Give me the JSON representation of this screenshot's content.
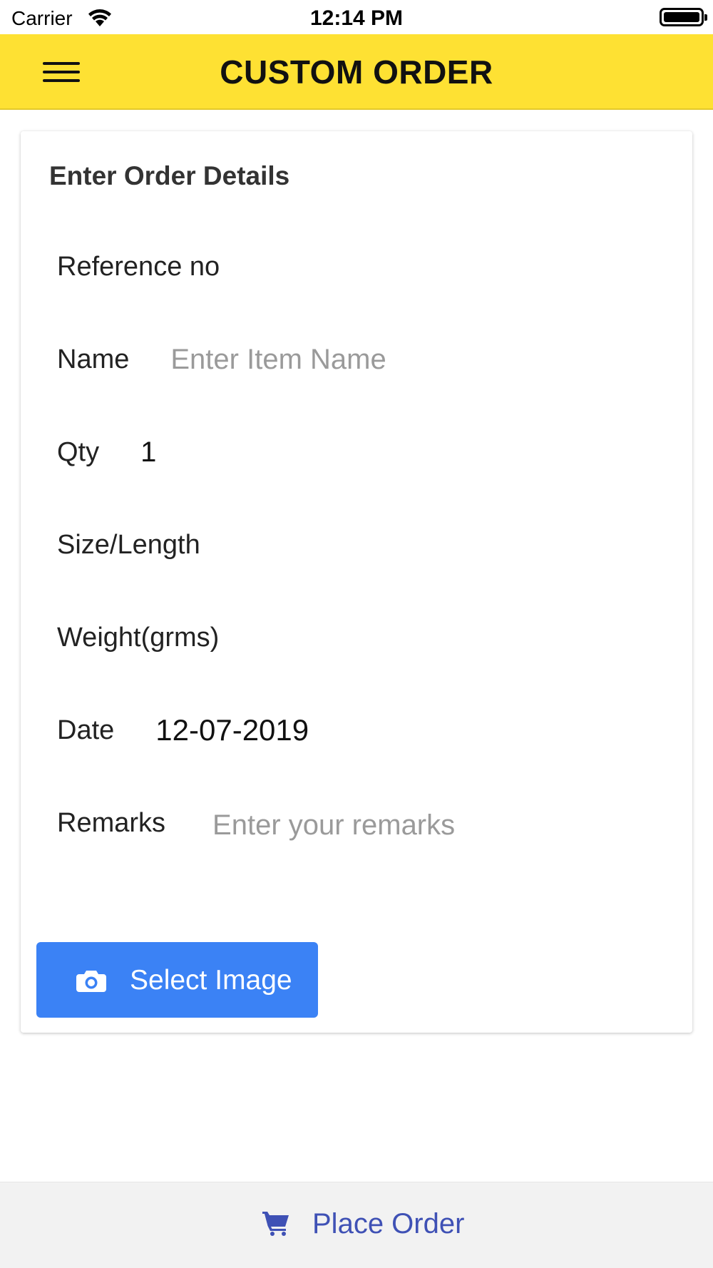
{
  "status_bar": {
    "carrier": "Carrier",
    "time": "12:14 PM",
    "icons": [
      "wifi-icon",
      "battery-icon"
    ]
  },
  "header": {
    "title": "CUSTOM ORDER",
    "menu_icon": "hamburger-menu-icon",
    "background": "#fee133"
  },
  "form": {
    "title": "Enter Order Details",
    "reference": {
      "label": "Reference no",
      "value": ""
    },
    "name": {
      "label": "Name",
      "value": "",
      "placeholder": "Enter Item Name"
    },
    "qty": {
      "label": "Qty",
      "value": "1"
    },
    "size": {
      "label": "Size/Length",
      "value": ""
    },
    "weight": {
      "label": "Weight(grms)",
      "value": ""
    },
    "date": {
      "label": "Date",
      "value": "12-07-2019"
    },
    "remarks": {
      "label": "Remarks",
      "value": "",
      "placeholder": "Enter your remarks"
    },
    "select_image": {
      "label": "Select Image",
      "icon": "camera-icon",
      "color": "#3b82f5"
    }
  },
  "footer": {
    "place_order": {
      "label": "Place Order",
      "icon": "cart-icon",
      "color": "#3f51b5"
    }
  }
}
